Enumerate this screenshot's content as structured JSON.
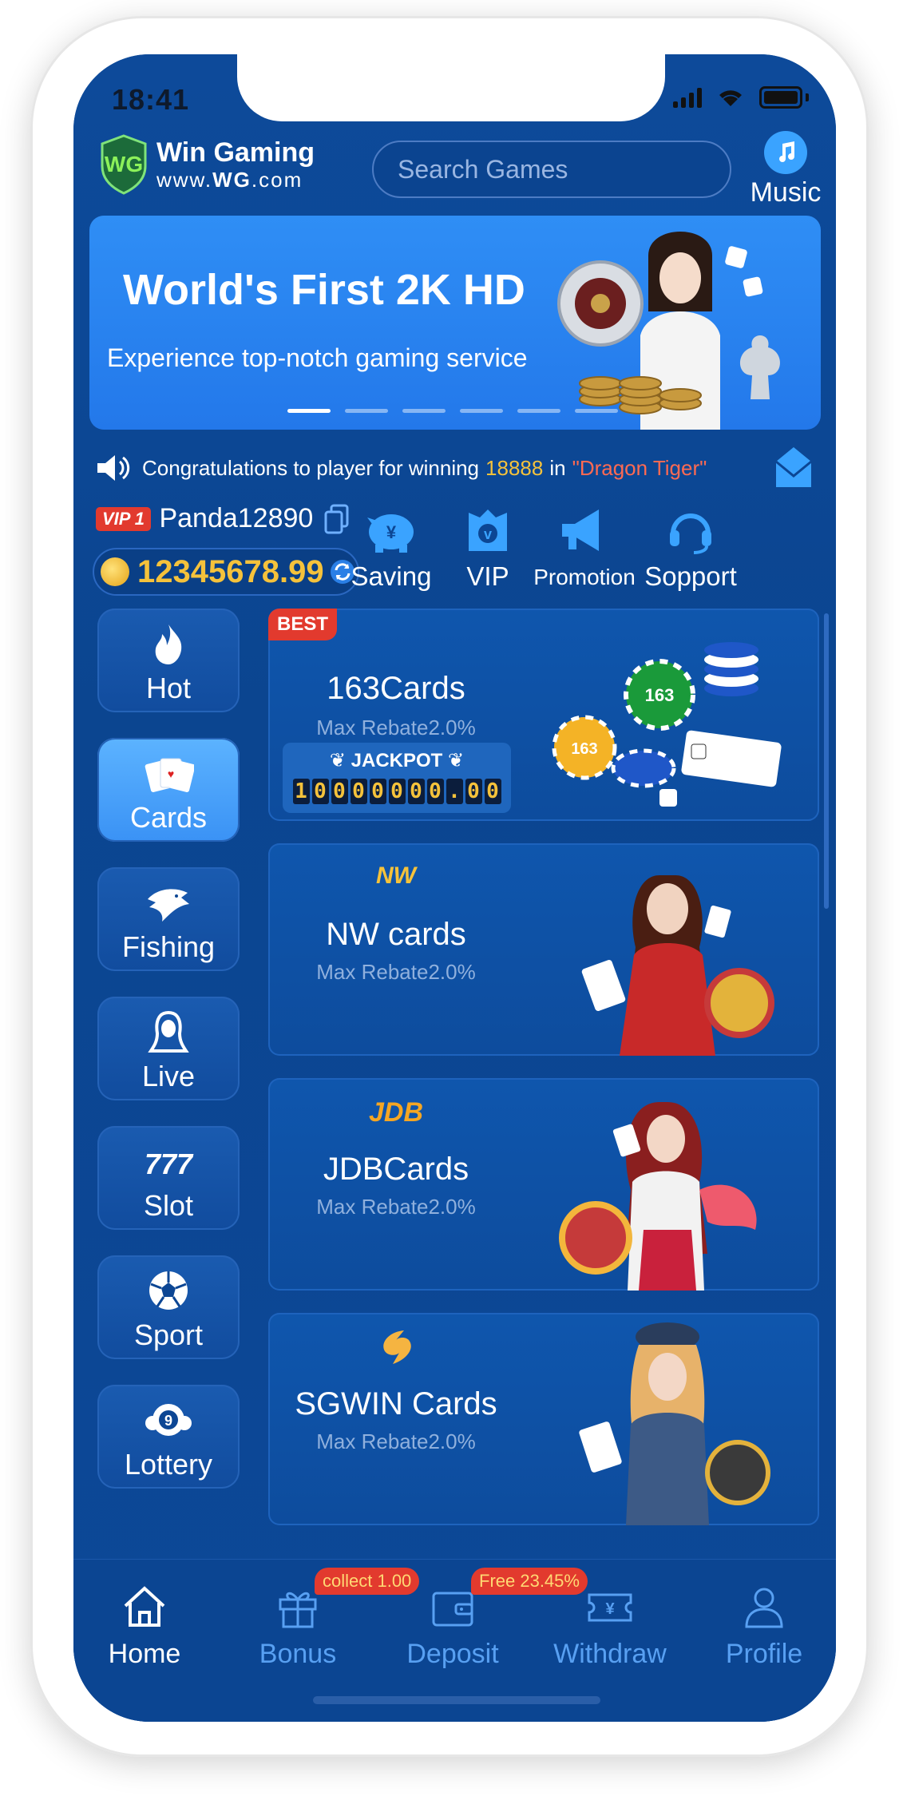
{
  "status": {
    "time": "18:41"
  },
  "header": {
    "logo_title": "Win Gaming",
    "logo_url_prefix": "www.",
    "logo_url_brand": "WG",
    "logo_url_suffix": ".com",
    "search_placeholder": "Search Games",
    "music_label": "Music"
  },
  "banner": {
    "title": "World's First 2K HD",
    "subtitle": "Experience top-notch gaming service",
    "slide_count": 6,
    "active_slide": 1
  },
  "notice": {
    "prefix": "Congratulations to player for winning",
    "amount": "18888",
    "connector": "in",
    "game": "\"Dragon Tiger\""
  },
  "user": {
    "vip_level": "VIP 1",
    "username": "Panda12890",
    "balance": "12345678.99"
  },
  "quick_actions": [
    {
      "label": "Saving",
      "icon": "piggy-bank-icon"
    },
    {
      "label": "VIP",
      "icon": "vip-crown-icon"
    },
    {
      "label": "Promotion",
      "icon": "megaphone-icon"
    },
    {
      "label": "Sopport",
      "icon": "headset-icon"
    }
  ],
  "categories": [
    {
      "label": "Hot",
      "icon": "flame-icon",
      "active": false
    },
    {
      "label": "Cards",
      "icon": "playing-cards-icon",
      "active": true
    },
    {
      "label": "Fishing",
      "icon": "shark-icon",
      "active": false
    },
    {
      "label": "Live",
      "icon": "woman-icon",
      "active": false
    },
    {
      "label": "Slot",
      "icon": "triple-seven-icon",
      "active": false
    },
    {
      "label": "Sport",
      "icon": "soccer-ball-icon",
      "active": false
    },
    {
      "label": "Lottery",
      "icon": "lottery-ball-icon",
      "active": false
    }
  ],
  "games": [
    {
      "title": "163Cards",
      "rebate": "Max Rebate2.0%",
      "badge": "BEST",
      "jackpot_label": "JACKPOT",
      "jackpot_value": "10000000.00"
    },
    {
      "title": "NW cards",
      "rebate": "Max Rebate2.0%",
      "brand": "NW"
    },
    {
      "title": "JDBCards",
      "rebate": "Max Rebate2.0%",
      "brand": "JDB"
    },
    {
      "title": "SGWIN Cards",
      "rebate": "Max Rebate2.0%",
      "brand": "SG"
    }
  ],
  "tabbar": {
    "items": [
      {
        "label": "Home",
        "icon": "home-icon",
        "active": true
      },
      {
        "label": "Bonus",
        "icon": "gift-icon",
        "active": false,
        "pill": "collect  1.00"
      },
      {
        "label": "Deposit",
        "icon": "wallet-icon",
        "active": false,
        "pill": "Free 23.45%"
      },
      {
        "label": "Withdraw",
        "icon": "yen-ticket-icon",
        "active": false
      },
      {
        "label": "Profile",
        "icon": "person-icon",
        "active": false
      }
    ]
  },
  "colors": {
    "background": "#0c4694",
    "accent_gold": "#f5c23b",
    "accent_red": "#e23a2e",
    "active_tab": "#ffffff",
    "inactive_tab": "#58a0f2"
  }
}
